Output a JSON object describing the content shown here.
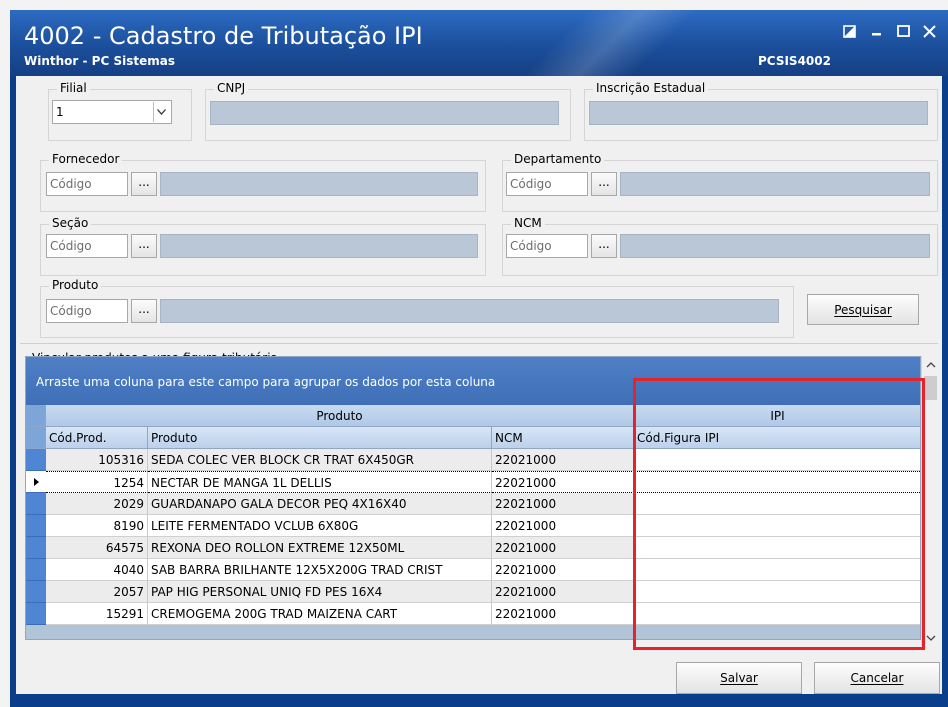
{
  "window": {
    "title": "4002 - Cadastro de Tributação IPI",
    "subtitle": "Winthor - PC Sistemas",
    "routine_code": "PCSIS4002"
  },
  "filters": {
    "filial": {
      "label": "Filial",
      "value": "1"
    },
    "cnpj": {
      "label": "CNPJ",
      "value": ""
    },
    "inscricao": {
      "label": "Inscrição Estadual",
      "value": ""
    },
    "fornecedor": {
      "label": "Fornecedor",
      "placeholder": "Código",
      "dots": "..."
    },
    "departamento": {
      "label": "Departamento",
      "placeholder": "Código",
      "dots": "..."
    },
    "secao": {
      "label": "Seção",
      "placeholder": "Código",
      "dots": "..."
    },
    "ncm": {
      "label": "NCM",
      "placeholder": "Código",
      "dots": "..."
    },
    "produto": {
      "label": "Produto",
      "placeholder": "Código",
      "dots": "..."
    },
    "search_button": "Pesquisar"
  },
  "grid": {
    "section_label": "Vincular produtos a uma figura tributária",
    "group_panel_text": "Arraste uma coluna para este campo para agrupar os dados por esta coluna",
    "bands": {
      "produto": "Produto",
      "ipi": "IPI"
    },
    "columns": {
      "cod": "Cód.Prod.",
      "produto": "Produto",
      "ncm": "NCM",
      "figura": "Cód.Figura IPI"
    },
    "rows": [
      {
        "cod": "105316",
        "produto": "SEDA COLEC VER BLOCK CR TRAT 6X450GR",
        "ncm": "22021000",
        "figura": ""
      },
      {
        "cod": "1254",
        "produto": "NECTAR DE MANGA 1L DELLIS",
        "ncm": "22021000",
        "figura": ""
      },
      {
        "cod": "2029",
        "produto": "GUARDANAPO GALA DECOR PEQ 4X16X40",
        "ncm": "22021000",
        "figura": ""
      },
      {
        "cod": "8190",
        "produto": "LEITE FERMENTADO VCLUB 6X80G",
        "ncm": "22021000",
        "figura": ""
      },
      {
        "cod": "64575",
        "produto": "REXONA DEO ROLLON EXTREME 12X50ML",
        "ncm": "22021000",
        "figura": ""
      },
      {
        "cod": "4040",
        "produto": "SAB BARRA BRILHANTE 12X5X200G TRAD CRIST",
        "ncm": "22021000",
        "figura": ""
      },
      {
        "cod": "2057",
        "produto": "PAP HIG PERSONAL UNIQ FD PES 16X4",
        "ncm": "22021000",
        "figura": ""
      },
      {
        "cod": "15291",
        "produto": "CREMOGEMA 200G TRAD MAIZENA CART",
        "ncm": "22021000",
        "figura": ""
      }
    ]
  },
  "footer": {
    "save": "Salvar",
    "cancel": "Cancelar"
  },
  "colors": {
    "title_bar": "#1b4f9c",
    "highlight": "#e5232b",
    "group_panel": "#4f7fc5"
  }
}
